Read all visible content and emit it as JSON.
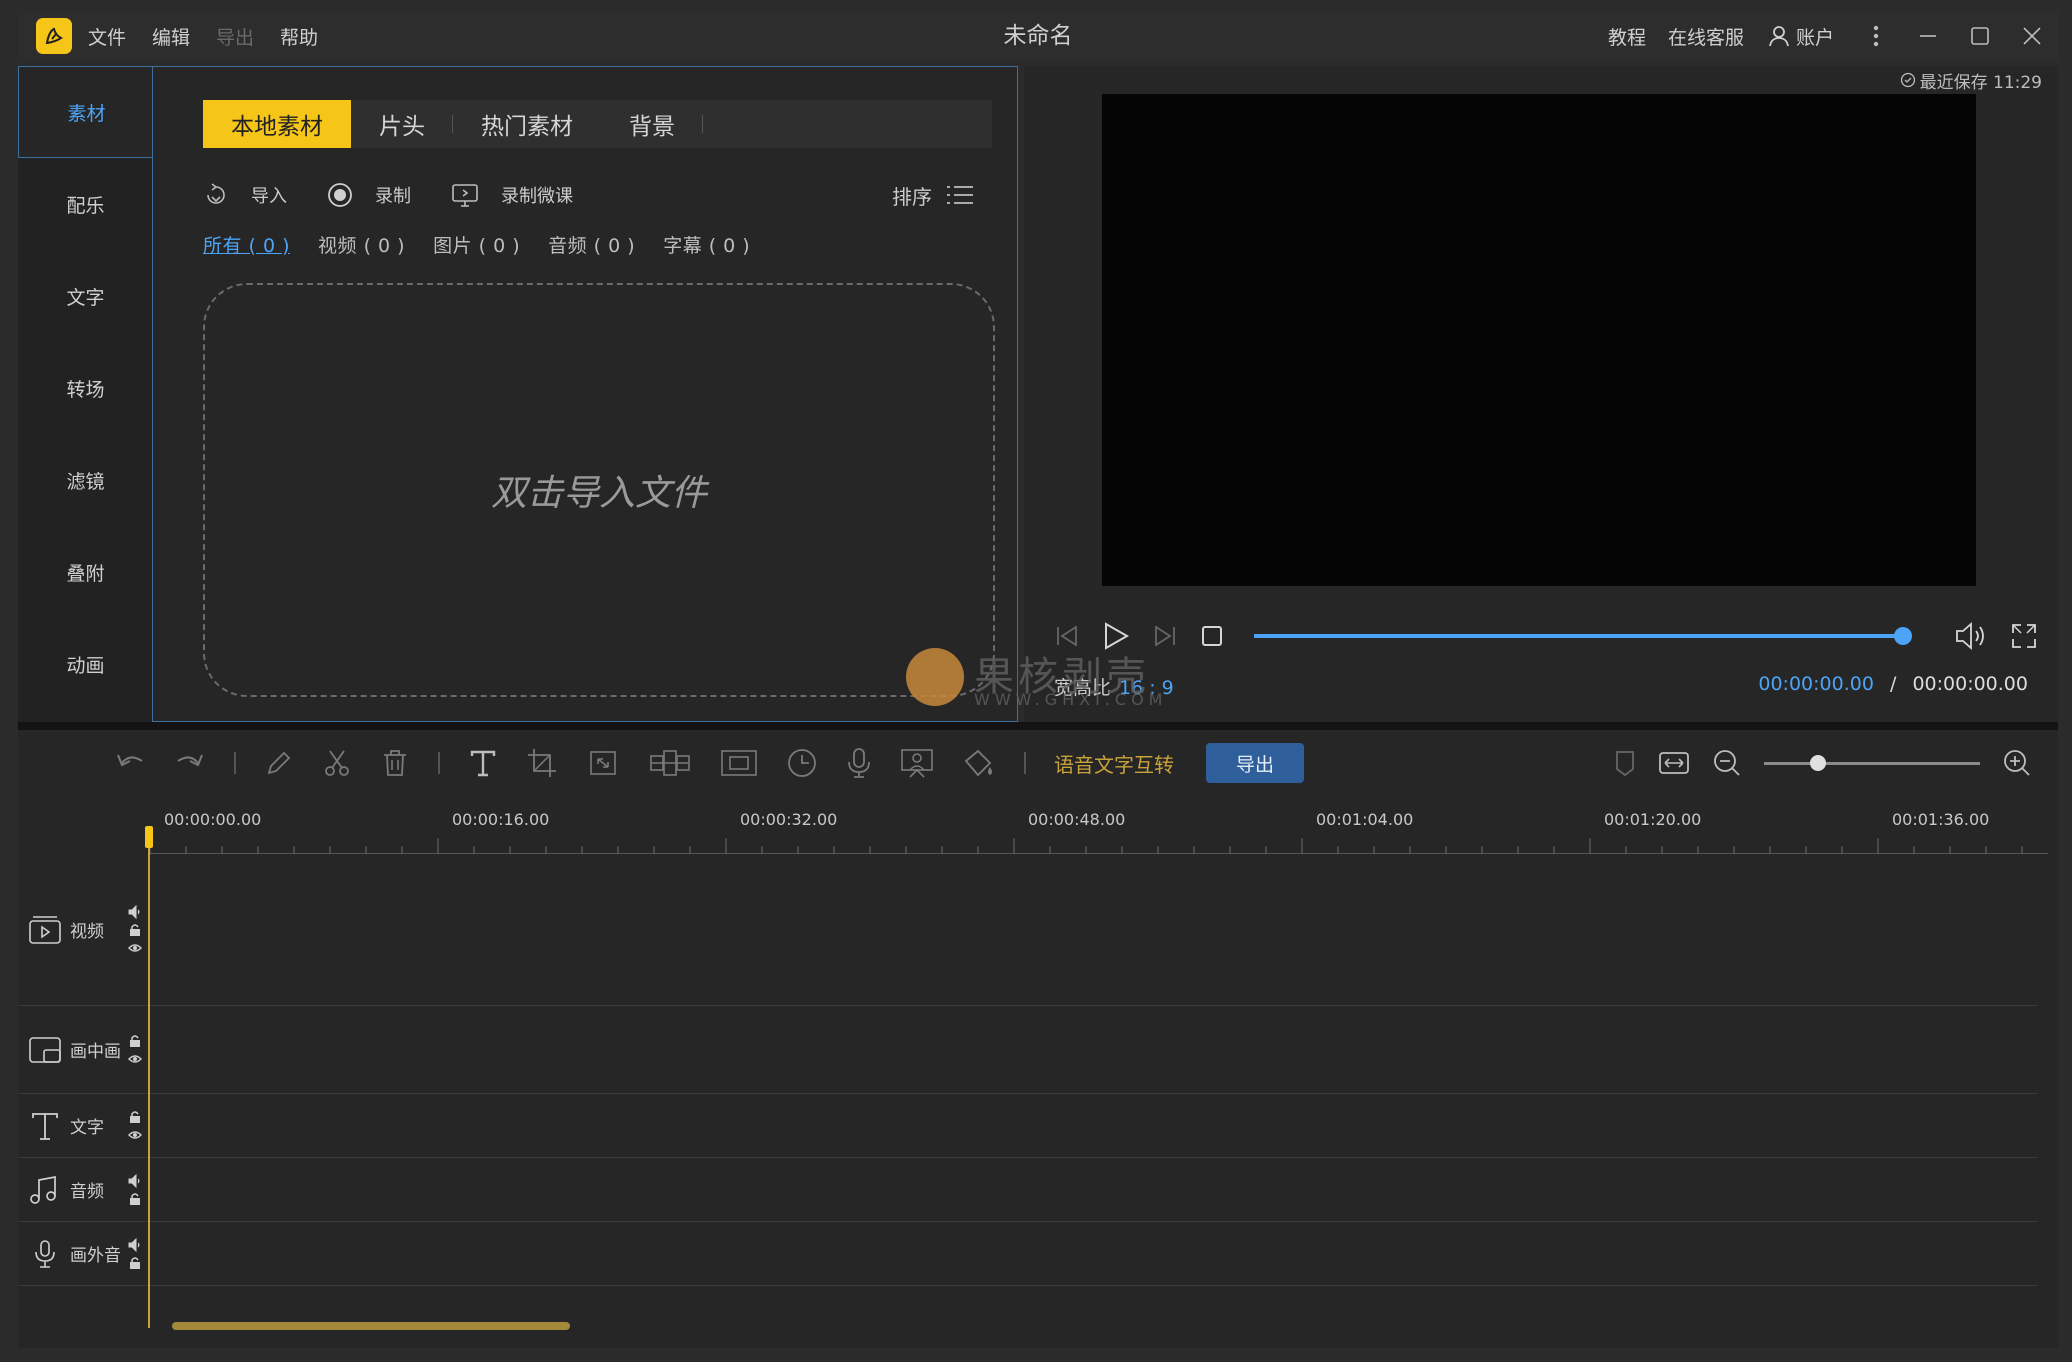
{
  "titlebar": {
    "title": "未命名",
    "menu": [
      "文件",
      "编辑",
      "导出",
      "帮助"
    ],
    "tutorial": "教程",
    "support": "在线客服",
    "account": "账户"
  },
  "sidenav": {
    "items": [
      "素材",
      "配乐",
      "文字",
      "转场",
      "滤镜",
      "叠附",
      "动画"
    ]
  },
  "media": {
    "tabs": [
      "本地素材",
      "片头",
      "热门素材",
      "背景"
    ],
    "tools": {
      "import": "导入",
      "record": "录制",
      "record_course": "录制微课",
      "sort": "排序"
    },
    "filters": [
      "所有 ( 0 )",
      "视频 ( 0 )",
      "图片 ( 0 )",
      "音频 ( 0 )",
      "字幕 ( 0 )"
    ],
    "dropzone_text": "双击导入文件"
  },
  "preview": {
    "saved": "最近保存 11:29",
    "aspect_label": "宽高比",
    "aspect_value": "16 : 9",
    "time_current": "00:00:00.00",
    "time_sep": "/",
    "time_total": "00:00:00.00",
    "progress": 1.0
  },
  "watermark": {
    "text": "果核剥壳",
    "sub": "WWW.GHXI.COM"
  },
  "timeline_toolbar": {
    "speech_to_text": "语音文字互转",
    "export": "导出",
    "zoom_level": 0.25
  },
  "timeline": {
    "ruler_labels": [
      "00:00:00.00",
      "00:00:16.00",
      "00:00:32.00",
      "00:00:48.00",
      "00:01:04.00",
      "00:01:20.00",
      "00:01:36.00"
    ],
    "tracks": [
      "视频",
      "画中画",
      "文字",
      "音频",
      "画外音"
    ]
  },
  "colors": {
    "accent_yellow": "#f5c518",
    "accent_blue": "#4da3f5",
    "export_button": "#2e5f9a"
  }
}
